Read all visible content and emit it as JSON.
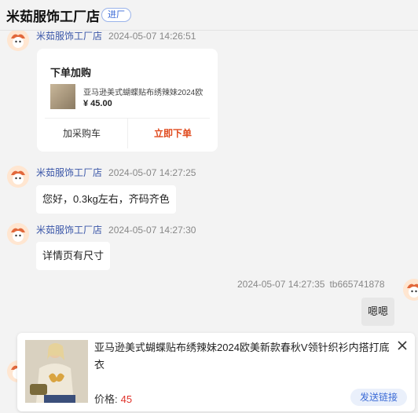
{
  "header": {
    "title": "米茹服饰工厂店",
    "badge": "进厂"
  },
  "messages": {
    "m0": {
      "sender": "米茹服饰工厂店",
      "time": "2024-05-07 14:26:51"
    },
    "card": {
      "title": "下单加购",
      "product": "亚马逊美式蝴蝶贴布绣辣妹2024欧",
      "price": "¥ 45.00",
      "add_cart": "加采购车",
      "buy_now": "立即下单"
    },
    "m1": {
      "sender": "米茹服饰工厂店",
      "time": "2024-05-07 14:27:25",
      "text": "您好，0.3kg左右，齐码齐色"
    },
    "m2": {
      "sender": "米茹服饰工厂店",
      "time": "2024-05-07 14:27:30",
      "text": "详情页有尺寸"
    },
    "m3": {
      "time": "2024-05-07 14:27:35",
      "user": "tb665741878",
      "text": "嗯嗯"
    }
  },
  "promo": {
    "title": "亚马逊美式蝴蝶贴布绣辣妹2024欧美新款春秋V领针织衫内搭打底衣",
    "price_label": "价格:",
    "price": "45",
    "send_link": "发送链接"
  },
  "colors": {
    "accent": "#3a6ad6",
    "price": "#e0332b",
    "buy": "#e04a1d"
  }
}
